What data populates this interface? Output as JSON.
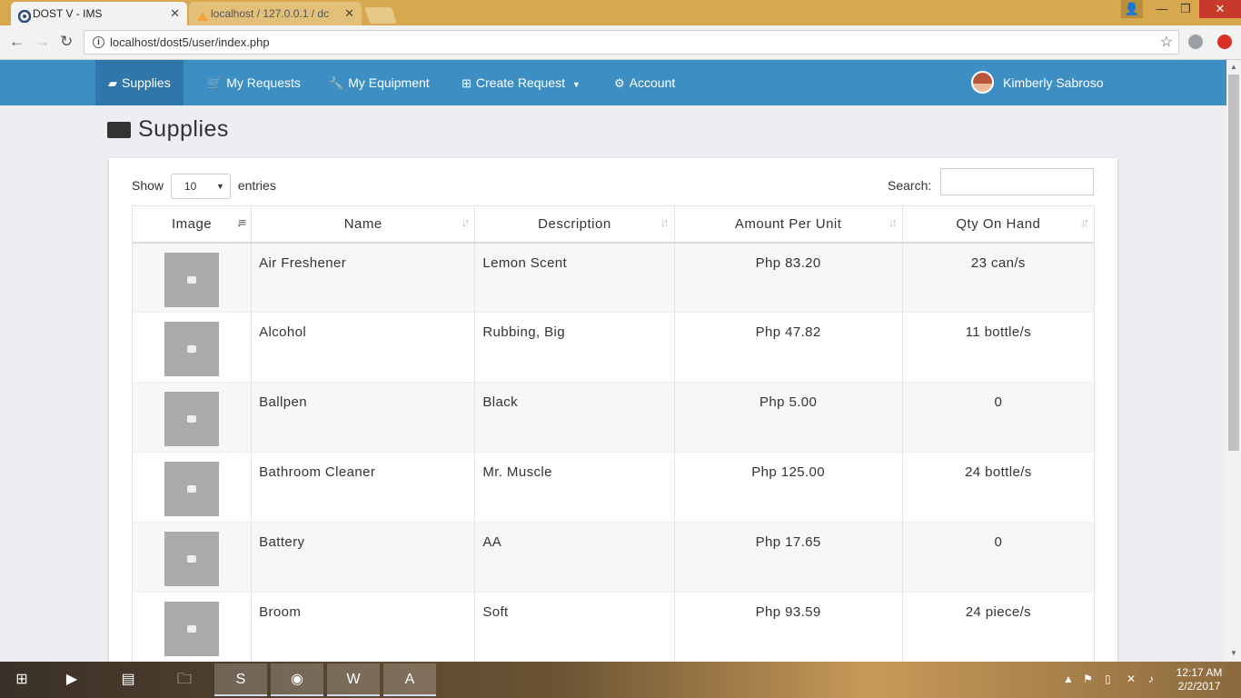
{
  "browser": {
    "tabs": [
      {
        "title": "DOST V - IMS",
        "active": true
      },
      {
        "title": "localhost / 127.0.0.1 / dc",
        "active": false
      }
    ],
    "url": "localhost/dost5/user/index.php",
    "icons": [
      "back-icon",
      "forward-icon",
      "reload-icon",
      "info-icon",
      "star-icon",
      "extension-icon",
      "opera-icon"
    ]
  },
  "navbar": {
    "items": [
      {
        "label": "Supplies",
        "icon": "folder-open-icon"
      },
      {
        "label": "My Requests",
        "icon": "shopping-cart-icon"
      },
      {
        "label": "My Equipment",
        "icon": "wrench-icon"
      },
      {
        "label": "Create Request",
        "icon": "plus-square-icon"
      },
      {
        "label": "Account",
        "icon": "gear-icon"
      }
    ],
    "user": "Kimberly Sabroso",
    "color": "#3d8ec2",
    "active_color": "#2f77a8"
  },
  "page": {
    "title": "Supplies"
  },
  "table_controls": {
    "show_label": "Show",
    "entries_value": "10",
    "entries_label": "entries",
    "search_label": "Search:"
  },
  "table": {
    "columns": [
      "Image",
      "Name",
      "Description",
      "Amount Per Unit",
      "Qty On Hand"
    ],
    "rows": [
      {
        "name": "Air Freshener",
        "description": "Lemon Scent",
        "amount": "Php 83.20",
        "qty": "23 can/s"
      },
      {
        "name": "Alcohol",
        "description": "Rubbing, Big",
        "amount": "Php 47.82",
        "qty": "11 bottle/s"
      },
      {
        "name": "Ballpen",
        "description": "Black",
        "amount": "Php 5.00",
        "qty": "0"
      },
      {
        "name": "Bathroom Cleaner",
        "description": "Mr. Muscle",
        "amount": "Php 125.00",
        "qty": "24 bottle/s"
      },
      {
        "name": "Battery",
        "description": "AA",
        "amount": "Php 17.65",
        "qty": "0"
      },
      {
        "name": "Broom",
        "description": "Soft",
        "amount": "Php 93.59",
        "qty": "24 piece/s"
      }
    ]
  },
  "taskbar": {
    "time": "12:17 AM",
    "date": "2/2/2017"
  }
}
